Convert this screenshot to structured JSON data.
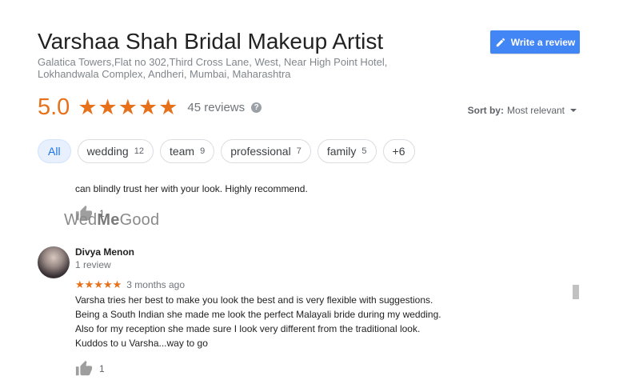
{
  "business": {
    "name": "Varshaa Shah Bridal Makeup Artist",
    "address": "Galatica Towers,Flat no 302,Third Cross Lane, West, Near High Point Hotel, Lokhandwala Complex, Andheri, Mumbai, Maharashtra"
  },
  "write_review_label": "Write a review",
  "rating": {
    "value": "5.0",
    "stars": 5,
    "reviews_label": "45 reviews",
    "help_glyph": "?"
  },
  "sort": {
    "label": "Sort by:",
    "value": "Most relevant"
  },
  "filters": [
    {
      "label": "All",
      "count": ""
    },
    {
      "label": "wedding",
      "count": "12"
    },
    {
      "label": "team",
      "count": "9"
    },
    {
      "label": "professional",
      "count": "7"
    },
    {
      "label": "family",
      "count": "5"
    },
    {
      "label": "+6",
      "count": ""
    }
  ],
  "previous_review": {
    "snippet": "can blindly trust her with your look. Highly recommend.",
    "likes": "1"
  },
  "watermark": {
    "part1": "Wed",
    "part2": "Me",
    "part3": "Good"
  },
  "review": {
    "name": "Divya Menon",
    "meta": "1 review",
    "stars": 5,
    "time": "3 months ago",
    "text": "Varsha tries her best to make you look the best and is very flexible with suggestions.\nBeing a South Indian she made me look the perfect Malayali bride during my wedding.\nAlso for my reception she made sure I look very different from the traditional look.\nKuddos to u Varsha...way to go",
    "likes": "1"
  },
  "colors": {
    "accent_orange": "#e7711b",
    "button_blue": "#4285f4",
    "chip_active_bg": "#e8f0fe",
    "chip_active_text": "#1a73e8"
  },
  "icons": [
    "pencil-icon",
    "star-icon",
    "help-icon",
    "thumbs-up-icon",
    "caret-down-icon"
  ]
}
